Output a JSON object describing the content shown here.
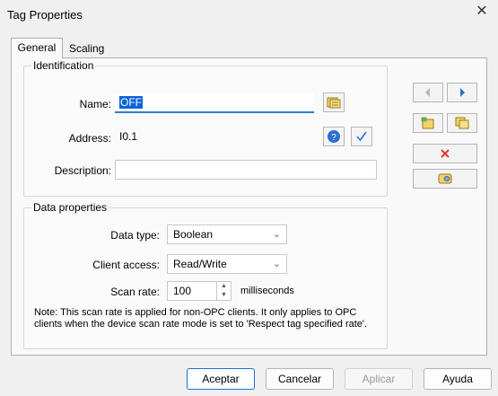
{
  "window": {
    "title": "Tag Properties",
    "close_glyph": "✕"
  },
  "tabs": [
    {
      "label": "General",
      "active": true
    },
    {
      "label": "Scaling",
      "active": false
    }
  ],
  "identification": {
    "legend": "Identification",
    "name_label": "Name:",
    "name_value": "OFF",
    "address_label": "Address:",
    "address_value": "I0.1",
    "description_label": "Description:",
    "description_value": ""
  },
  "data_properties": {
    "legend": "Data properties",
    "data_type_label": "Data type:",
    "data_type_value": "Boolean",
    "client_access_label": "Client access:",
    "client_access_value": "Read/Write",
    "scan_rate_label": "Scan rate:",
    "scan_rate_value": "100",
    "scan_rate_unit": "milliseconds",
    "note": "Note: This scan rate is applied for non-OPC clients. It only applies to OPC clients when the device scan rate mode is set to 'Respect tag specified rate'."
  },
  "side_buttons": {
    "prev_icon": "arrow-left-icon",
    "next_icon": "arrow-right-icon",
    "new_tag_icon": "new-tag-icon",
    "copy_tag_icon": "copy-tag-icon",
    "delete_icon": "delete-icon",
    "import_icon": "database-icon"
  },
  "buttons": {
    "accept": "Aceptar",
    "cancel": "Cancelar",
    "apply": "Aplicar",
    "help": "Ayuda"
  },
  "colors": {
    "accent": "#2f78d4",
    "selection": "#0a64d6",
    "delete": "#e5352b"
  }
}
